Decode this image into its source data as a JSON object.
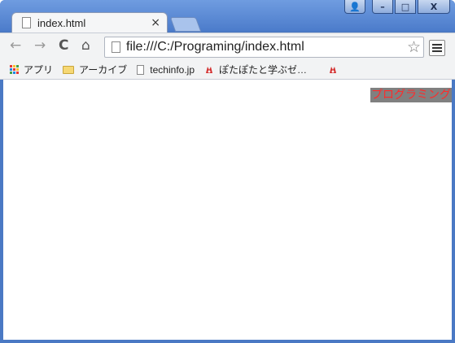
{
  "tab": {
    "title": "index.html",
    "close_label": "×"
  },
  "window_controls": {
    "user": "👤",
    "minimize": "–",
    "maximize": "□",
    "close": "X"
  },
  "toolbar": {
    "back": "←",
    "forward": "→",
    "reload": "C",
    "home": "⌂"
  },
  "address_bar": {
    "url": "file:///C:/Programing/index.html",
    "star": "☆"
  },
  "bookmarks": [
    {
      "label": "アプリ",
      "icon": "apps-grid-icon"
    },
    {
      "label": "アーカイブ",
      "icon": "folder-icon"
    },
    {
      "label": "techinfo.jp",
      "icon": "page-icon"
    },
    {
      "label": "ぽたぽたと学ぶゼ…",
      "icon": "ponta-icon"
    },
    {
      "label": "",
      "icon": "ponta-icon"
    }
  ],
  "page": {
    "heading": "プログラミング"
  },
  "colors": {
    "accent_red": "#ff2a2a",
    "heading_bg": "#808080",
    "frame_blue": "#4a79c4"
  }
}
